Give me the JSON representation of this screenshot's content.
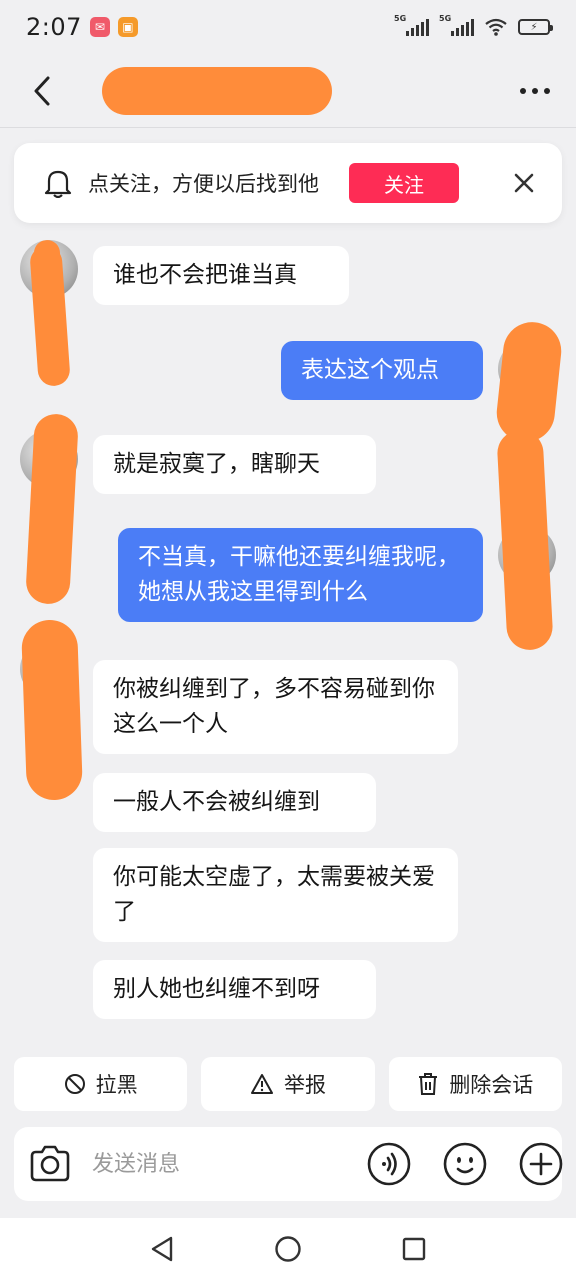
{
  "status_bar": {
    "time": "2:07",
    "network_1": "5G",
    "network_2": "5G",
    "battery_label": "⚡"
  },
  "header": {
    "contact_name": "▇▇▇▇▇▇"
  },
  "follow_banner": {
    "text": "点关注，方便以后找到他",
    "button_label": "关注"
  },
  "messages": [
    {
      "side": "in",
      "text": "谁也不会把谁当真"
    },
    {
      "side": "out",
      "text": "表达这个观点"
    },
    {
      "side": "in",
      "text": "就是寂寞了，瞎聊天"
    },
    {
      "side": "out",
      "text": "不当真，干嘛他还要纠缠我呢，她想从我这里得到什么"
    },
    {
      "side": "in",
      "text": "你被纠缠到了，多不容易碰到你这么一个人"
    },
    {
      "side": "in",
      "text": "一般人不会被纠缠到"
    },
    {
      "side": "in",
      "text": "你可能太空虚了，太需要被关爱了"
    },
    {
      "side": "in",
      "text": "别人她也纠缠不到呀"
    }
  ],
  "actions": {
    "block_label": "拉黑",
    "report_label": "举报",
    "delete_label": "删除会话"
  },
  "input_bar": {
    "placeholder": "发送消息"
  },
  "colors": {
    "accent_red": "#fe2c55",
    "bubble_blue": "#4b7df6",
    "redaction_orange": "#ff8c3a"
  }
}
